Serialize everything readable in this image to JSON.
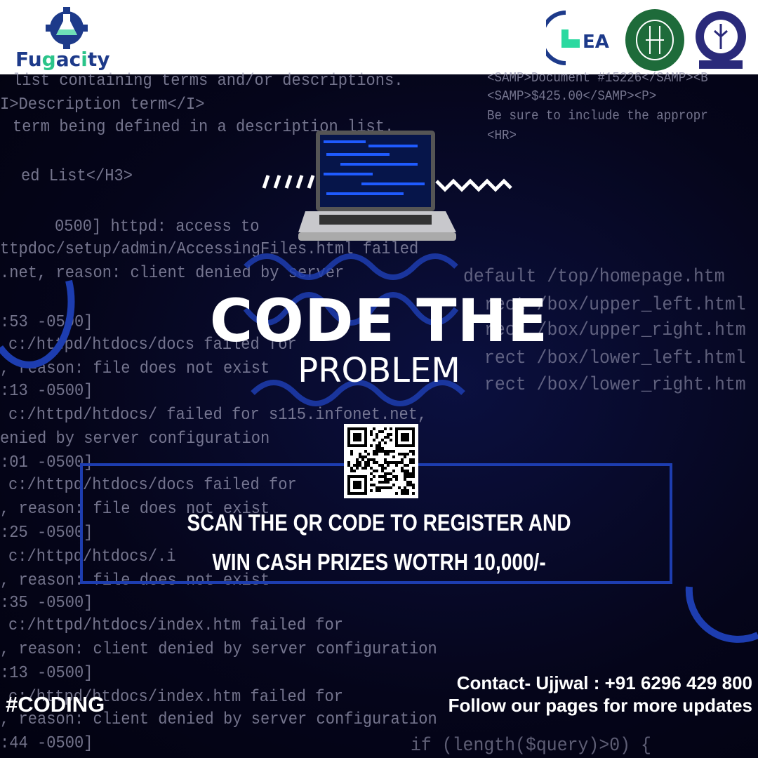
{
  "brand": {
    "name_part1": "Fu",
    "name_part2": "g",
    "name_part3": "a",
    "name_part4": "c",
    "name_part5": "i",
    "name_part6": "ty",
    "partner_logos": [
      "ChEA logo",
      "Indian Institute of Chemical Engineers seal",
      "IIT Kharagpur seal"
    ]
  },
  "code_left": [
    "list containing terms and/or descriptions.",
    "I>Description term</I>",
    "term being defined in a description list.",
    "ed List</H3>",
    "0500] httpd: access to",
    "ttpdoc/setup/admin/AccessingFiles.html failed",
    ".net, reason: client denied by server",
    ":53 -0500]",
    "c:/httpd/htdocs/docs failed for",
    ", reason: file does not exist",
    ":13 -0500]",
    "c:/httpd/htdocs/ failed for s115.infonet.net,",
    "enied by server configuration",
    ":01 -0500]",
    "c:/httpd/htdocs/docs failed for",
    ", reason: file does not exist",
    ":25 -0500]",
    "c:/httpd/htdocs/.i",
    ", reason: file does not exist",
    ":35 -0500]",
    "c:/httpd/htdocs/index.htm failed for",
    ", reason: client denied by server configuration",
    ":13 -0500]",
    "c:/httpd/htdocs/index.htm failed for",
    ", reason: client denied by server configuration",
    ":44 -0500]"
  ],
  "code_right": [
    "<SAMP>Document #15226</SAMP><B",
    "<SAMP>$425.00</SAMP><P>",
    "Be sure to include the appropr",
    "<HR>"
  ],
  "code_right_big": [
    "default /top/homepage.htm",
    "rect /box/upper_left.html",
    "rect /box/upper_right.htm",
    "rect /box/lower_left.html",
    "rect /box/lower_right.htm"
  ],
  "code_bottom": "if (length($query)>0) {",
  "headline": {
    "line1": "CODE THE",
    "line2": "PROBLEM"
  },
  "cta": {
    "line1": "SCAN THE QR CODE TO REGISTER AND",
    "line2": "WIN CASH PRIZES WOTRH 10,000/-"
  },
  "hashtag": "#CODING",
  "contact": "Contact- Ujjwal : +91 6296 429 800",
  "follow": "Follow our pages for more updates",
  "colors": {
    "accent": "#1d3db0",
    "brand_blue": "#1d3a8a",
    "brand_green": "#2bc48a"
  }
}
